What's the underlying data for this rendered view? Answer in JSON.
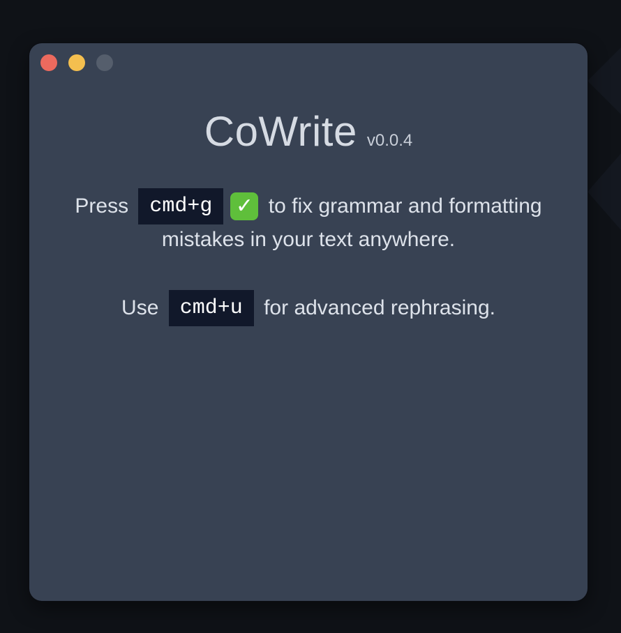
{
  "window": {
    "title": "CoWrite",
    "version": "v0.0.4"
  },
  "traffic_lights": {
    "colors": {
      "close": "#ec6a5e",
      "minimize": "#f4bf4f",
      "zoom": "#555e6c"
    }
  },
  "instructions": {
    "line1_before": "Press",
    "shortcut_grammar": "cmd+g",
    "check_icon": "✓",
    "line1_after": "to fix grammar and formatting",
    "line2": "mistakes in your text anywhere.",
    "line3_before": "Use",
    "shortcut_rephrase": "cmd+u",
    "line3_after": "for advanced rephrasing."
  },
  "colors": {
    "window_bg": "#384253",
    "kbd_bg": "#11182a",
    "check_bg": "#5fbf3b"
  }
}
